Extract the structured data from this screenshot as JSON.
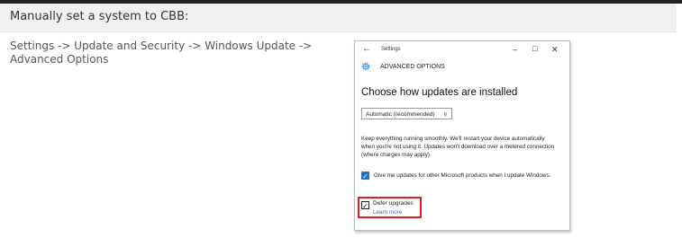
{
  "header": {
    "title": "Manually set a system to CBB:"
  },
  "instructions": {
    "path": "Settings -> Update and Security -> Windows Update -> Advanced Options"
  },
  "window": {
    "title": "Settings",
    "back_glyph": "←",
    "minimize_glyph": "–",
    "maximize_glyph": "□",
    "close_glyph": "✕",
    "page_heading": "ADVANCED OPTIONS",
    "subheading": "Choose how updates are installed",
    "dropdown": {
      "selected": "Automatic (recommended)",
      "chevron": "⌵"
    },
    "description": "Keep everything running smoothly. We'll restart your device automatically when you're not using it. Updates won't download over a metered connection (where charges may apply).",
    "checkbox_ms_updates": {
      "label": "Give me updates for other Microsoft products when I update Windows.",
      "checked": true
    },
    "checkbox_defer": {
      "label": "Defer upgrades",
      "checked": true
    },
    "learn_more": "Learn more",
    "icons": {
      "gear": "gear-icon",
      "back": "back-arrow-icon"
    },
    "colors": {
      "accent": "#1e73c9",
      "highlight": "#e01b24"
    }
  }
}
